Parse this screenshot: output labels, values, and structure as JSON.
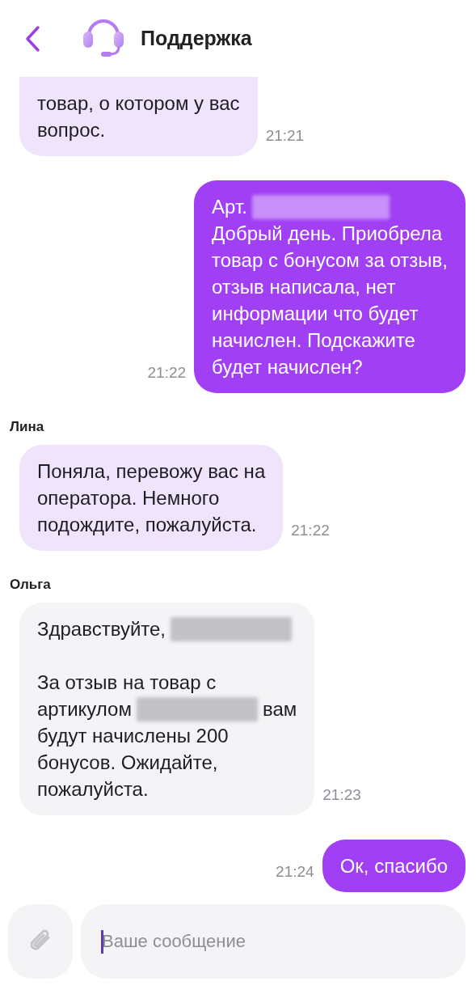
{
  "header": {
    "title": "Поддержка"
  },
  "messages": [
    {
      "kind": "bot",
      "time": "21:21",
      "paragraphs": [
        [
          [
            {
              "kind": "text",
              "text": "товар, о котором у вас"
            }
          ],
          [
            {
              "kind": "text",
              "text": "вопрос."
            }
          ]
        ]
      ]
    },
    {
      "kind": "user",
      "time": "21:22",
      "paragraphs": [
        [
          [
            {
              "kind": "text",
              "text": "Арт."
            },
            {
              "kind": "redaction"
            }
          ],
          [
            {
              "kind": "text",
              "text": "Добрый день. Приобрела"
            }
          ],
          [
            {
              "kind": "text",
              "text": "товар с бонусом за отзыв,"
            }
          ],
          [
            {
              "kind": "text",
              "text": "отзыв написала, нет"
            }
          ],
          [
            {
              "kind": "text",
              "text": "информации что будет"
            }
          ],
          [
            {
              "kind": "text",
              "text": "начислен. Подскажите"
            }
          ],
          [
            {
              "kind": "text",
              "text": "будет начислен?"
            }
          ]
        ]
      ]
    },
    {
      "kind": "bot",
      "sender": "Лина",
      "time": "21:22",
      "paragraphs": [
        [
          [
            {
              "kind": "text",
              "text": "Поняла, перевожу вас на"
            }
          ],
          [
            {
              "kind": "text",
              "text": "оператора. Немного"
            }
          ],
          [
            {
              "kind": "text",
              "text": "подождите, пожалуйста."
            }
          ]
        ]
      ]
    },
    {
      "kind": "operator",
      "sender": "Ольга",
      "time": "21:23",
      "paragraphs": [
        [
          [
            {
              "kind": "text",
              "text": "Здравствуйте,"
            },
            {
              "kind": "redaction"
            }
          ]
        ],
        [
          [
            {
              "kind": "text",
              "text": "За отзыв на товар с"
            }
          ],
          [
            {
              "kind": "text",
              "text": "артикулом"
            },
            {
              "kind": "redaction"
            },
            {
              "kind": "text",
              "text": "вам"
            }
          ],
          [
            {
              "kind": "text",
              "text": "будут начислены 200"
            }
          ],
          [
            {
              "kind": "text",
              "text": "бонусов. Ожидайте,"
            }
          ],
          [
            {
              "kind": "text",
              "text": "пожалуйста."
            }
          ]
        ]
      ]
    },
    {
      "kind": "user",
      "time": "21:24",
      "paragraphs": [
        [
          [
            {
              "kind": "text",
              "text": "Ок, спасибо"
            }
          ]
        ]
      ]
    }
  ],
  "composer": {
    "placeholder": "Ваше сообщение"
  }
}
